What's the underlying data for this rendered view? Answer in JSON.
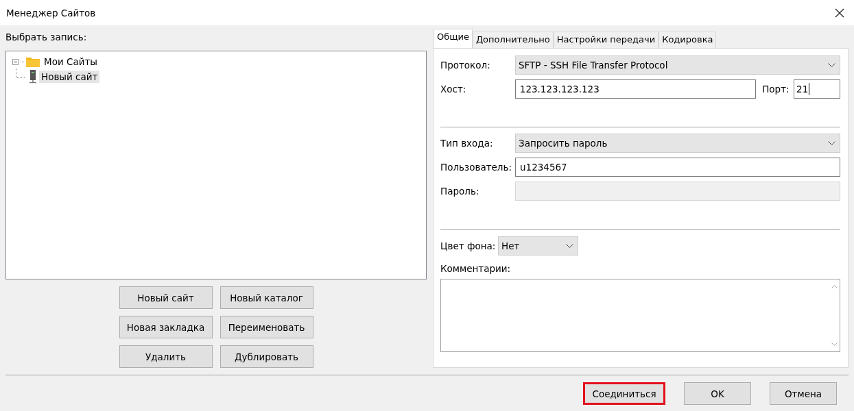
{
  "window": {
    "title": "Менеджер Сайтов"
  },
  "tree": {
    "label": "Выбрать запись:",
    "items": [
      {
        "label": "Мои Сайты",
        "kind": "folder",
        "expanded": true,
        "selected": false,
        "children": [
          {
            "label": "Новый сайт",
            "kind": "site",
            "selected": true
          }
        ]
      }
    ]
  },
  "site_buttons": [
    "Новый сайт",
    "Новый каталог",
    "Новая закладка",
    "Переименовать",
    "Удалить",
    "Дублировать"
  ],
  "tabs": [
    {
      "label": "Общие",
      "selected": true
    },
    {
      "label": "Дополнительно",
      "selected": false
    },
    {
      "label": "Настройки передачи",
      "selected": false
    },
    {
      "label": "Кодировка",
      "selected": false
    }
  ],
  "general": {
    "protocol_label": "Протокол:",
    "protocol": "SFTP - SSH File Transfer Protocol",
    "host_label": "Хост:",
    "host": "123.123.123.123",
    "port_label": "Порт:",
    "port": "21",
    "logon_label": "Тип входа:",
    "logon": "Запросить пароль",
    "user_label": "Пользователь:",
    "user": "u1234567",
    "password_label": "Пароль:",
    "password_disabled": true,
    "bg_label": "Цвет фона:",
    "bg": "Нет",
    "comments_label": "Комментарии:"
  },
  "footer_buttons": [
    {
      "label": "Соединиться",
      "highlighted": true
    },
    {
      "label": "OK",
      "highlighted": false
    },
    {
      "label": "Отмена",
      "highlighted": false
    }
  ]
}
